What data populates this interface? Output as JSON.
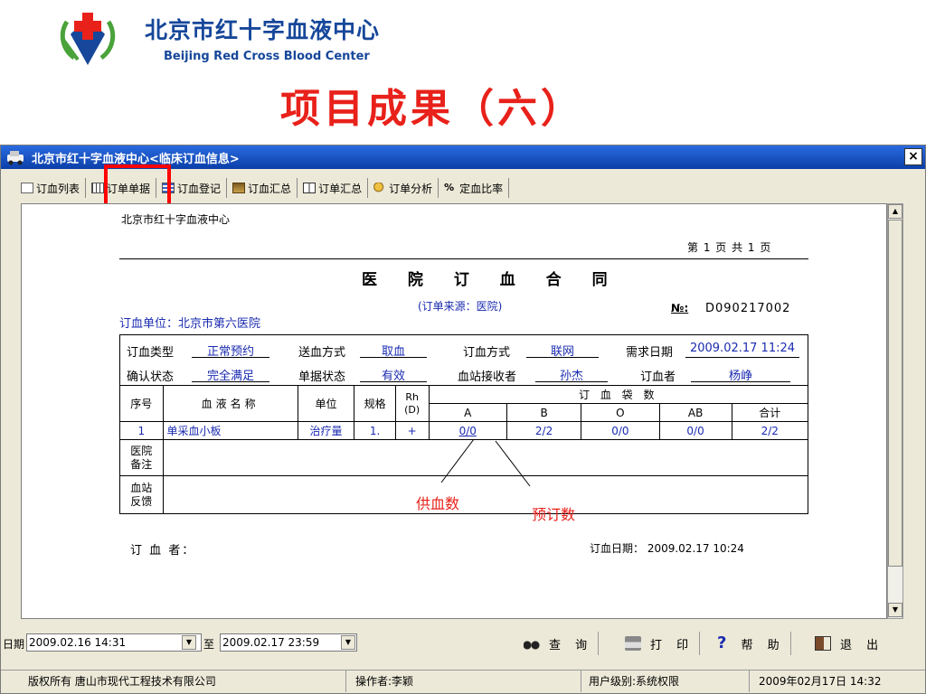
{
  "header": {
    "org_cn": "北京市红十字血液中心",
    "org_en": "Beijing Red Cross Blood Center",
    "slide_title": "项目成果（六）",
    "logo_icon": "red-cross-heart-hands-logo"
  },
  "window": {
    "title": "北京市红十字血液中心<临床订血信息>",
    "close_label": "×",
    "tabs": [
      {
        "label": "订血列表",
        "icon": "list-icon"
      },
      {
        "label": "订单单据",
        "icon": "grid-icon"
      },
      {
        "label": "订血登记",
        "icon": "register-icon"
      },
      {
        "label": "订血汇总",
        "icon": "summary-icon"
      },
      {
        "label": "订单汇总",
        "icon": "book-icon"
      },
      {
        "label": "订单分析",
        "icon": "key-icon"
      },
      {
        "label": "定血比率",
        "icon": "percent-icon",
        "glyph": "%"
      }
    ]
  },
  "document": {
    "hospital_header": "北京市红十字血液中心",
    "page_info": "第 1 页  共 1 页",
    "title": "医 院 订 血 合 同",
    "source": "(订单来源：医院)",
    "unit": "订血单位：北京市第六医院",
    "no_label": "№:",
    "no_value": "D090217002",
    "fields": {
      "order_type_label": "订血类型",
      "order_type": "正常预约",
      "delivery_label": "送血方式",
      "delivery": "取血",
      "order_method_label": "订血方式",
      "order_method": "联网",
      "need_date_label": "需求日期",
      "need_date": "2009.02.17 11:24",
      "confirm_label": "确认状态",
      "confirm": "完全满足",
      "status_label": "单据状态",
      "status": "有效",
      "receiver_label": "血站接收者",
      "receiver": "孙杰",
      "orderer_label": "订血者",
      "orderer": "杨峥"
    },
    "table": {
      "headers": {
        "seq": "序号",
        "name": "血液名称",
        "unit": "单位",
        "spec": "规格",
        "rh": "Rh\n(D)",
        "bags": "订 血 袋 数",
        "a": "A",
        "b": "B",
        "o": "O",
        "ab": "AB",
        "total": "合计"
      },
      "row": {
        "seq": "1",
        "name": "单采血小板",
        "unit": "治疗量",
        "spec": "1.",
        "rh": "+",
        "a": "0/0",
        "b": "2/2",
        "o": "0/0",
        "ab": "0/0",
        "total": "2/2"
      },
      "hosp_remark_label": "医院\n备注",
      "station_feedback_label": "血站\n反馈"
    },
    "orderer_footer": "订 血 者：",
    "order_date": "订血日期：  2009.02.17 10:24",
    "annotations": {
      "supply": "供血数",
      "ordered": "预订数"
    }
  },
  "toolbar": {
    "date_label": "日期",
    "date_from": "2009.02.16 14:31",
    "to_label": "至",
    "date_to": "2009.02.17 23:59",
    "query": "查 询",
    "print": "打 印",
    "help": "帮 助",
    "exit": "退 出"
  },
  "status": {
    "copyright": "版权所有  唐山市现代工程技术有限公司",
    "operator": "操作者:李颖",
    "level": "用户级别:系统权限",
    "datetime": "2009年02月17日  14:32"
  },
  "colors": {
    "brand_blue": "#16479a",
    "title_red": "#e8211a",
    "highlight": "#ff0000",
    "value_blue": "#1a2bb0"
  }
}
